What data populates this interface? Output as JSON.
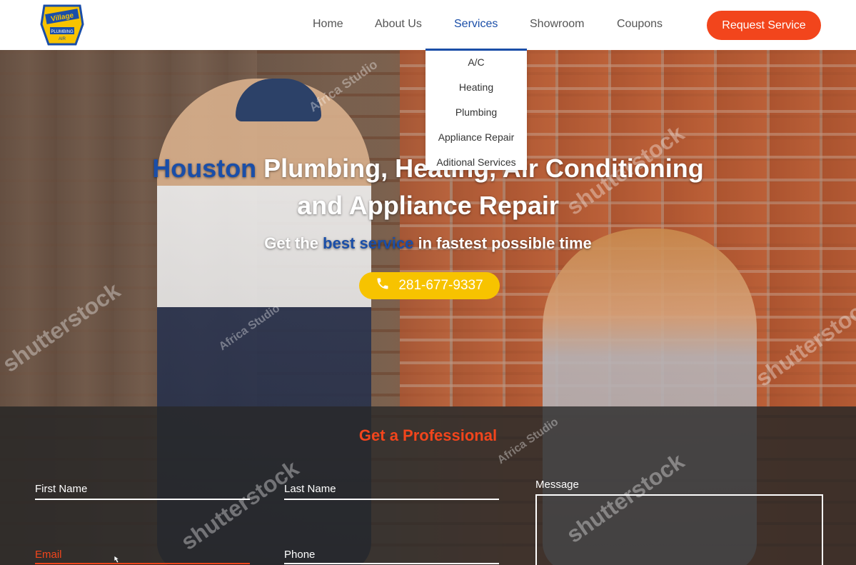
{
  "brand": {
    "logo_text_top": "Village",
    "logo_text_bottom": "PLUMBING AIR"
  },
  "nav": {
    "items": [
      {
        "label": "Home"
      },
      {
        "label": "About Us"
      },
      {
        "label": "Services"
      },
      {
        "label": "Showroom"
      },
      {
        "label": "Coupons"
      }
    ],
    "cta_label": "Request Service"
  },
  "services_dropdown": {
    "items": [
      {
        "label": "A/C"
      },
      {
        "label": "Heating"
      },
      {
        "label": "Plumbing"
      },
      {
        "label": "Appliance Repair"
      },
      {
        "label": "Aditional Services"
      }
    ]
  },
  "hero": {
    "headline_highlight": "Houston",
    "headline_line1_rest": " Plumbing, Heating, Air Conditioning",
    "headline_line2": "and Appliance Repair",
    "sub_before": "Get the ",
    "sub_highlight": "best service",
    "sub_after": " in fastest possible time",
    "phone": "281-677-9337"
  },
  "form": {
    "title": "Get a Professional",
    "first_name": "First Name",
    "last_name": "Last Name",
    "message": "Message",
    "email": "Email",
    "phone": "Phone"
  },
  "watermarks": {
    "shutterstock": "shutterstock",
    "studio": "Africa Studio"
  },
  "colors": {
    "accent_orange": "#f2451c",
    "brand_blue": "#1a4ea8",
    "phone_yellow": "#f7c300"
  }
}
